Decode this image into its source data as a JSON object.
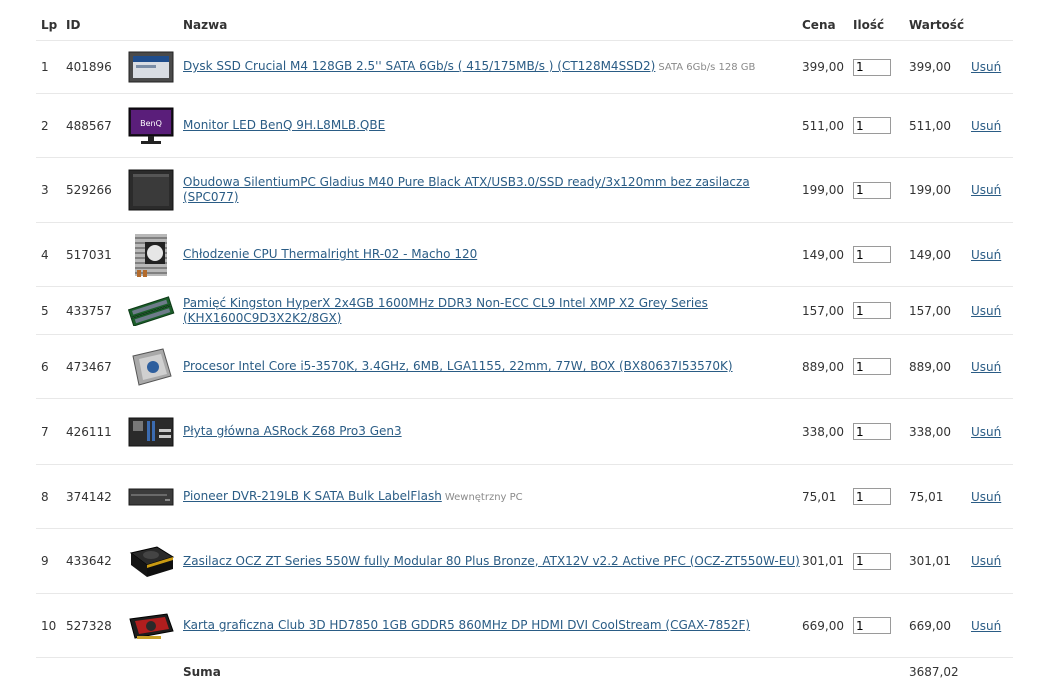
{
  "table": {
    "headers": {
      "lp": "Lp",
      "id": "ID",
      "name": "Nazwa",
      "price": "Cena",
      "qty": "Ilość",
      "value": "Wartość"
    },
    "rows": [
      {
        "lp": "1",
        "id": "401896",
        "name": "Dysk SSD Crucial M4 128GB 2.5'' SATA 6Gb/s ( 415/175MB/s ) (CT128M4SSD2)",
        "note": "SATA 6Gb/s 128 GB",
        "price": "399,00",
        "qty": "1",
        "value": "399,00",
        "remove": "Usuń",
        "icon": "ssd-drive-icon"
      },
      {
        "lp": "2",
        "id": "488567",
        "name": "Monitor LED BenQ 9H.L8MLB.QBE",
        "note": "",
        "price": "511,00",
        "qty": "1",
        "value": "511,00",
        "remove": "Usuń",
        "icon": "monitor-icon",
        "brand": "BenQ"
      },
      {
        "lp": "3",
        "id": "529266",
        "name": "Obudowa SilentiumPC Gladius M40 Pure Black ATX/USB3.0/SSD ready/3x120mm bez zasilacza (SPC077)",
        "note": "",
        "price": "199,00",
        "qty": "1",
        "value": "199,00",
        "remove": "Usuń",
        "icon": "pc-case-icon"
      },
      {
        "lp": "4",
        "id": "517031",
        "name": "Chłodzenie CPU Thermalright HR-02 - Macho 120",
        "note": "",
        "price": "149,00",
        "qty": "1",
        "value": "149,00",
        "remove": "Usuń",
        "icon": "cpu-cooler-icon"
      },
      {
        "lp": "5",
        "id": "433757",
        "name": "Pamięć Kingston HyperX 2x4GB 1600MHz DDR3 Non-ECC CL9 Intel XMP X2 Grey Series (KHX1600C9D3X2K2/8GX)",
        "note": "",
        "price": "157,00",
        "qty": "1",
        "value": "157,00",
        "remove": "Usuń",
        "icon": "ram-module-icon"
      },
      {
        "lp": "6",
        "id": "473467",
        "name": "Procesor Intel Core i5-3570K, 3.4GHz, 6MB, LGA1155, 22mm, 77W, BOX (BX80637I53570K)",
        "note": "",
        "price": "889,00",
        "qty": "1",
        "value": "889,00",
        "remove": "Usuń",
        "icon": "cpu-icon"
      },
      {
        "lp": "7",
        "id": "426111",
        "name": "Płyta główna ASRock Z68 Pro3 Gen3",
        "note": "",
        "price": "338,00",
        "qty": "1",
        "value": "338,00",
        "remove": "Usuń",
        "icon": "motherboard-icon"
      },
      {
        "lp": "8",
        "id": "374142",
        "name": "Pioneer DVR-219LB K SATA Bulk LabelFlash",
        "note": "Wewnętrzny PC",
        "price": "75,01",
        "qty": "1",
        "value": "75,01",
        "remove": "Usuń",
        "icon": "optical-drive-icon"
      },
      {
        "lp": "9",
        "id": "433642",
        "name": "Zasilacz OCZ ZT Series 550W fully Modular 80 Plus Bronze, ATX12V v2.2 Active PFC (OCZ-ZT550W-EU)",
        "note": "",
        "price": "301,01",
        "qty": "1",
        "value": "301,01",
        "remove": "Usuń",
        "icon": "power-supply-icon"
      },
      {
        "lp": "10",
        "id": "527328",
        "name": "Karta graficzna Club 3D HD7850 1GB GDDR5 860MHz DP HDMI DVI CoolStream (CGAX-7852F)",
        "note": "",
        "price": "669,00",
        "qty": "1",
        "value": "669,00",
        "remove": "Usuń",
        "icon": "graphics-card-icon"
      }
    ],
    "sum_label": "Suma",
    "sum_value": "3687,02"
  },
  "colors": {
    "link": "#2a5c85",
    "border": "#e8e8e8",
    "text": "#333333",
    "note": "#8a8a8a"
  }
}
